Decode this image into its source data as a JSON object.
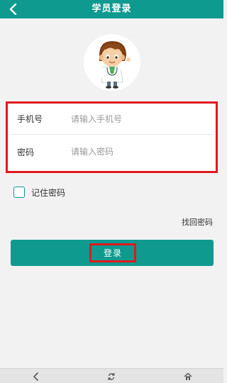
{
  "header": {
    "title": "学员登录",
    "back_icon": "chevron-left-icon",
    "background": "#0f9a8f"
  },
  "avatar": {
    "icon": "doctor-avatar"
  },
  "form": {
    "phone": {
      "label": "手机号",
      "placeholder": "请输入手机号",
      "value": ""
    },
    "password": {
      "label": "密码",
      "placeholder": "请输入密码",
      "value": ""
    }
  },
  "remember": {
    "label": "记住密码",
    "checked": false
  },
  "forgot_label": "找回密码",
  "login_button": {
    "label": "登录",
    "color": "#0f9a8f"
  },
  "bottom_nav": {
    "items": [
      {
        "icon": "back-arrow-icon"
      },
      {
        "icon": "refresh-icon"
      },
      {
        "icon": "home-icon"
      }
    ]
  },
  "highlight_color": "#e0191e"
}
